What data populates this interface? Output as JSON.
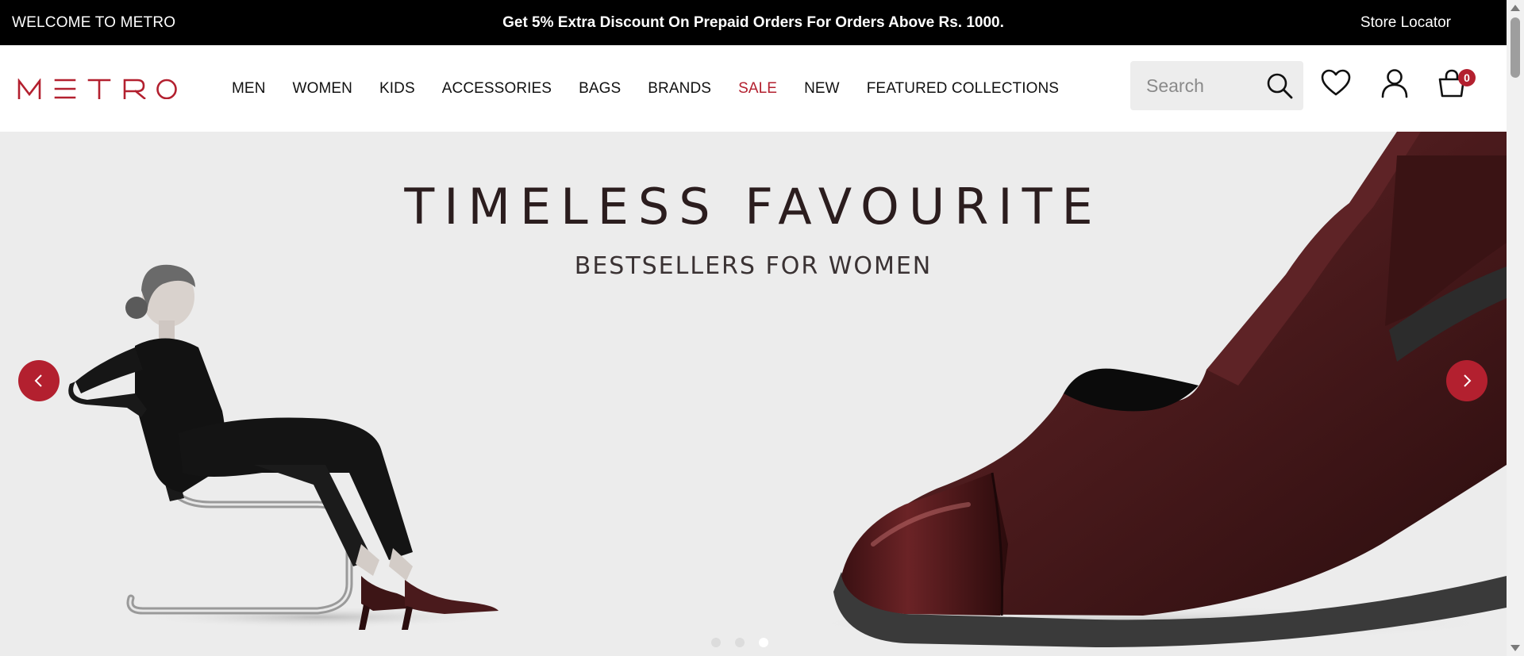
{
  "announcement": {
    "welcome": "WELCOME TO METRO",
    "promo": "Get 5% Extra Discount On Prepaid Orders For Orders Above Rs. 1000.",
    "store_locator": "Store Locator"
  },
  "header": {
    "logo_text": "METRO",
    "nav": [
      "MEN",
      "WOMEN",
      "KIDS",
      "ACCESSORIES",
      "BAGS",
      "BRANDS",
      "SALE",
      "NEW",
      "FEATURED COLLECTIONS"
    ],
    "search_placeholder": "Search",
    "cart_count": "0",
    "icons": [
      "search-icon",
      "heart-icon",
      "user-icon",
      "cart-icon"
    ]
  },
  "hero": {
    "title": "TIMELESS FAVOURITE",
    "subtitle": "BESTSELLERS FOR WOMEN",
    "slide_count": 3,
    "active_slide": 3
  },
  "colors": {
    "brand": "#b3202f",
    "topbar": "#000000",
    "hero_bg": "#ececec",
    "shoe": "#4a1a1c"
  }
}
